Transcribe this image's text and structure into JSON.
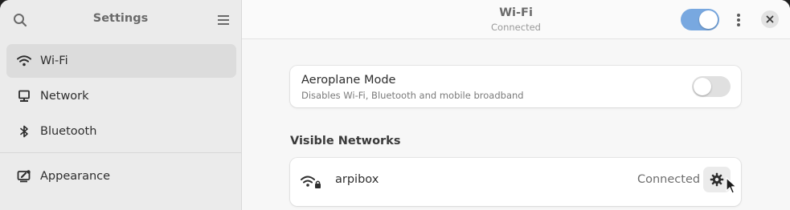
{
  "sidebar": {
    "title": "Settings",
    "items": [
      {
        "label": "Wi-Fi",
        "icon": "wifi-icon",
        "active": true
      },
      {
        "label": "Network",
        "icon": "network-icon",
        "active": false
      },
      {
        "label": "Bluetooth",
        "icon": "bluetooth-icon",
        "active": false
      },
      {
        "label": "Appearance",
        "icon": "appearance-icon",
        "active": false
      }
    ]
  },
  "header": {
    "title": "Wi-Fi",
    "subtitle": "Connected",
    "wifi_enabled": true
  },
  "airplane_mode": {
    "title": "Aeroplane Mode",
    "description": "Disables Wi-Fi, Bluetooth and mobile broadband",
    "enabled": false
  },
  "visible_networks": {
    "heading": "Visible Networks",
    "networks": [
      {
        "name": "arpibox",
        "status": "Connected",
        "secured": true
      }
    ]
  },
  "colors": {
    "accent": "#78a8e0",
    "sidebar_bg": "#ebebeb",
    "active_item": "#dcdcdc"
  }
}
